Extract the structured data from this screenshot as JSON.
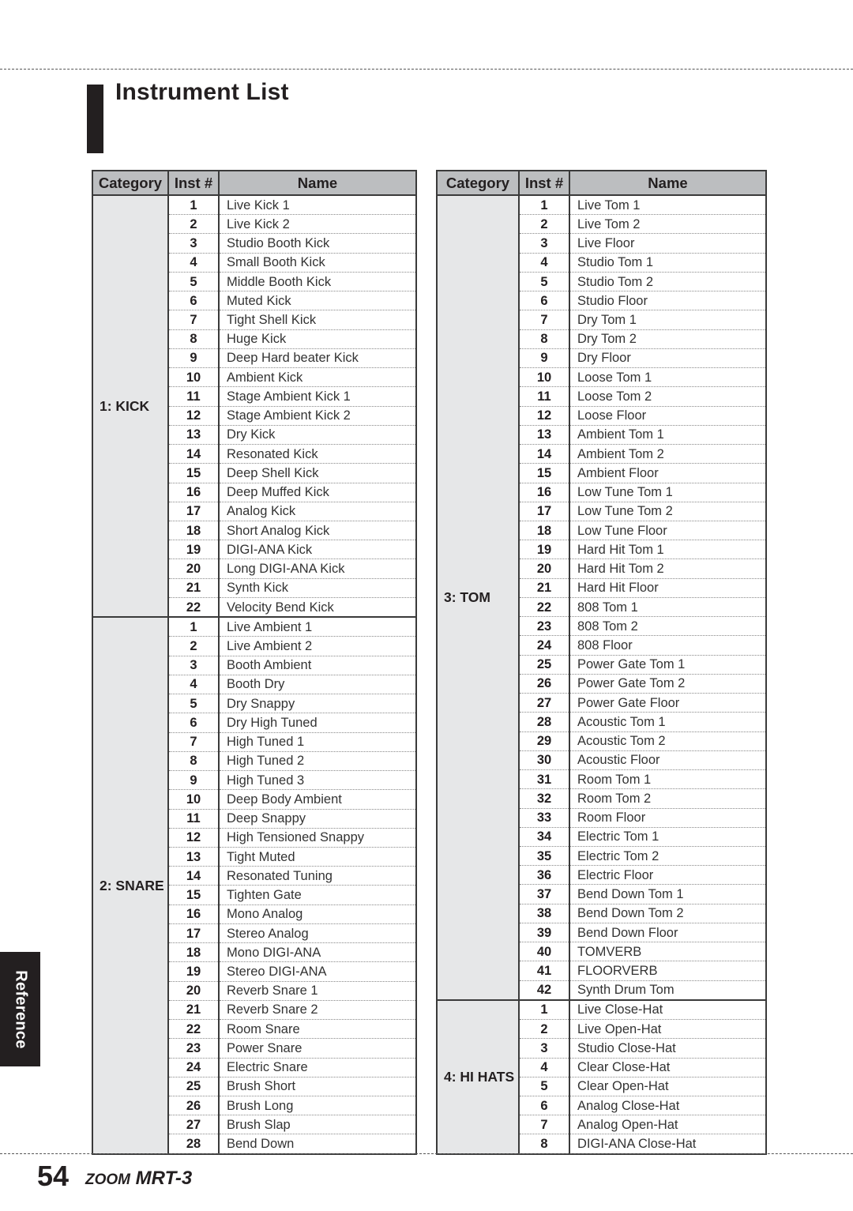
{
  "page": {
    "title": "Instrument List",
    "page_number": "54",
    "product_brand": "ZOOM",
    "product_model": "MRT-3",
    "side_tab": "Reference"
  },
  "table_headers": {
    "category": "Category",
    "inst": "Inst #",
    "name": "Name"
  },
  "colors": {
    "header_bg": "#bcbec0",
    "category_bg": "#e6e7e8",
    "tab_bg": "#231f20"
  },
  "tables": [
    {
      "groups": [
        {
          "category": "1: KICK",
          "items": [
            {
              "num": "1",
              "name": "Live Kick 1"
            },
            {
              "num": "2",
              "name": "Live Kick 2"
            },
            {
              "num": "3",
              "name": "Studio Booth Kick"
            },
            {
              "num": "4",
              "name": "Small Booth Kick"
            },
            {
              "num": "5",
              "name": "Middle Booth Kick"
            },
            {
              "num": "6",
              "name": "Muted Kick"
            },
            {
              "num": "7",
              "name": "Tight Shell Kick"
            },
            {
              "num": "8",
              "name": "Huge Kick"
            },
            {
              "num": "9",
              "name": "Deep Hard beater Kick"
            },
            {
              "num": "10",
              "name": "Ambient Kick"
            },
            {
              "num": "11",
              "name": "Stage Ambient Kick 1"
            },
            {
              "num": "12",
              "name": "Stage Ambient Kick 2"
            },
            {
              "num": "13",
              "name": "Dry Kick"
            },
            {
              "num": "14",
              "name": "Resonated Kick"
            },
            {
              "num": "15",
              "name": "Deep Shell Kick"
            },
            {
              "num": "16",
              "name": "Deep Muffed Kick"
            },
            {
              "num": "17",
              "name": "Analog Kick"
            },
            {
              "num": "18",
              "name": "Short Analog Kick"
            },
            {
              "num": "19",
              "name": "DIGI-ANA Kick"
            },
            {
              "num": "20",
              "name": "Long DIGI-ANA Kick"
            },
            {
              "num": "21",
              "name": "Synth Kick"
            },
            {
              "num": "22",
              "name": "Velocity Bend Kick"
            }
          ]
        },
        {
          "category": "2: SNARE",
          "items": [
            {
              "num": "1",
              "name": "Live Ambient 1"
            },
            {
              "num": "2",
              "name": "Live Ambient 2"
            },
            {
              "num": "3",
              "name": "Booth Ambient"
            },
            {
              "num": "4",
              "name": "Booth Dry"
            },
            {
              "num": "5",
              "name": "Dry Snappy"
            },
            {
              "num": "6",
              "name": "Dry High Tuned"
            },
            {
              "num": "7",
              "name": "High Tuned 1"
            },
            {
              "num": "8",
              "name": "High Tuned 2"
            },
            {
              "num": "9",
              "name": "High Tuned 3"
            },
            {
              "num": "10",
              "name": "Deep Body Ambient"
            },
            {
              "num": "11",
              "name": "Deep Snappy"
            },
            {
              "num": "12",
              "name": "High Tensioned Snappy"
            },
            {
              "num": "13",
              "name": "Tight Muted"
            },
            {
              "num": "14",
              "name": "Resonated Tuning"
            },
            {
              "num": "15",
              "name": "Tighten Gate"
            },
            {
              "num": "16",
              "name": "Mono Analog"
            },
            {
              "num": "17",
              "name": "Stereo Analog"
            },
            {
              "num": "18",
              "name": "Mono DIGI-ANA"
            },
            {
              "num": "19",
              "name": "Stereo DIGI-ANA"
            },
            {
              "num": "20",
              "name": "Reverb Snare 1"
            },
            {
              "num": "21",
              "name": "Reverb Snare 2"
            },
            {
              "num": "22",
              "name": "Room Snare"
            },
            {
              "num": "23",
              "name": "Power Snare"
            },
            {
              "num": "24",
              "name": "Electric Snare"
            },
            {
              "num": "25",
              "name": "Brush Short"
            },
            {
              "num": "26",
              "name": "Brush Long"
            },
            {
              "num": "27",
              "name": "Brush Slap"
            },
            {
              "num": "28",
              "name": "Bend Down"
            }
          ]
        }
      ]
    },
    {
      "groups": [
        {
          "category": "3: TOM",
          "items": [
            {
              "num": "1",
              "name": "Live Tom 1"
            },
            {
              "num": "2",
              "name": "Live Tom 2"
            },
            {
              "num": "3",
              "name": "Live Floor"
            },
            {
              "num": "4",
              "name": "Studio Tom 1"
            },
            {
              "num": "5",
              "name": "Studio Tom 2"
            },
            {
              "num": "6",
              "name": "Studio Floor"
            },
            {
              "num": "7",
              "name": "Dry Tom 1"
            },
            {
              "num": "8",
              "name": "Dry Tom 2"
            },
            {
              "num": "9",
              "name": "Dry Floor"
            },
            {
              "num": "10",
              "name": "Loose Tom 1"
            },
            {
              "num": "11",
              "name": "Loose Tom 2"
            },
            {
              "num": "12",
              "name": "Loose Floor"
            },
            {
              "num": "13",
              "name": "Ambient Tom 1"
            },
            {
              "num": "14",
              "name": "Ambient Tom 2"
            },
            {
              "num": "15",
              "name": "Ambient Floor"
            },
            {
              "num": "16",
              "name": "Low Tune Tom 1"
            },
            {
              "num": "17",
              "name": "Low Tune Tom 2"
            },
            {
              "num": "18",
              "name": "Low Tune Floor"
            },
            {
              "num": "19",
              "name": "Hard Hit Tom 1"
            },
            {
              "num": "20",
              "name": "Hard Hit Tom 2"
            },
            {
              "num": "21",
              "name": "Hard Hit Floor"
            },
            {
              "num": "22",
              "name": "808 Tom 1"
            },
            {
              "num": "23",
              "name": "808 Tom 2"
            },
            {
              "num": "24",
              "name": "808 Floor"
            },
            {
              "num": "25",
              "name": "Power Gate Tom 1"
            },
            {
              "num": "26",
              "name": "Power Gate Tom 2"
            },
            {
              "num": "27",
              "name": "Power Gate Floor"
            },
            {
              "num": "28",
              "name": "Acoustic Tom 1"
            },
            {
              "num": "29",
              "name": "Acoustic Tom 2"
            },
            {
              "num": "30",
              "name": "Acoustic Floor"
            },
            {
              "num": "31",
              "name": "Room Tom 1"
            },
            {
              "num": "32",
              "name": "Room Tom 2"
            },
            {
              "num": "33",
              "name": "Room Floor"
            },
            {
              "num": "34",
              "name": "Electric Tom 1"
            },
            {
              "num": "35",
              "name": "Electric Tom 2"
            },
            {
              "num": "36",
              "name": "Electric Floor"
            },
            {
              "num": "37",
              "name": "Bend Down Tom 1"
            },
            {
              "num": "38",
              "name": "Bend Down Tom 2"
            },
            {
              "num": "39",
              "name": "Bend Down Floor"
            },
            {
              "num": "40",
              "name": "TOMVERB"
            },
            {
              "num": "41",
              "name": "FLOORVERB"
            },
            {
              "num": "42",
              "name": "Synth Drum Tom"
            }
          ]
        },
        {
          "category": "4: HI HATS",
          "items": [
            {
              "num": "1",
              "name": "Live Close-Hat"
            },
            {
              "num": "2",
              "name": "Live Open-Hat"
            },
            {
              "num": "3",
              "name": "Studio Close-Hat"
            },
            {
              "num": "4",
              "name": "Clear Close-Hat"
            },
            {
              "num": "5",
              "name": "Clear Open-Hat"
            },
            {
              "num": "6",
              "name": "Analog Close-Hat"
            },
            {
              "num": "7",
              "name": "Analog Open-Hat"
            },
            {
              "num": "8",
              "name": "DIGI-ANA Close-Hat"
            }
          ]
        }
      ]
    }
  ]
}
